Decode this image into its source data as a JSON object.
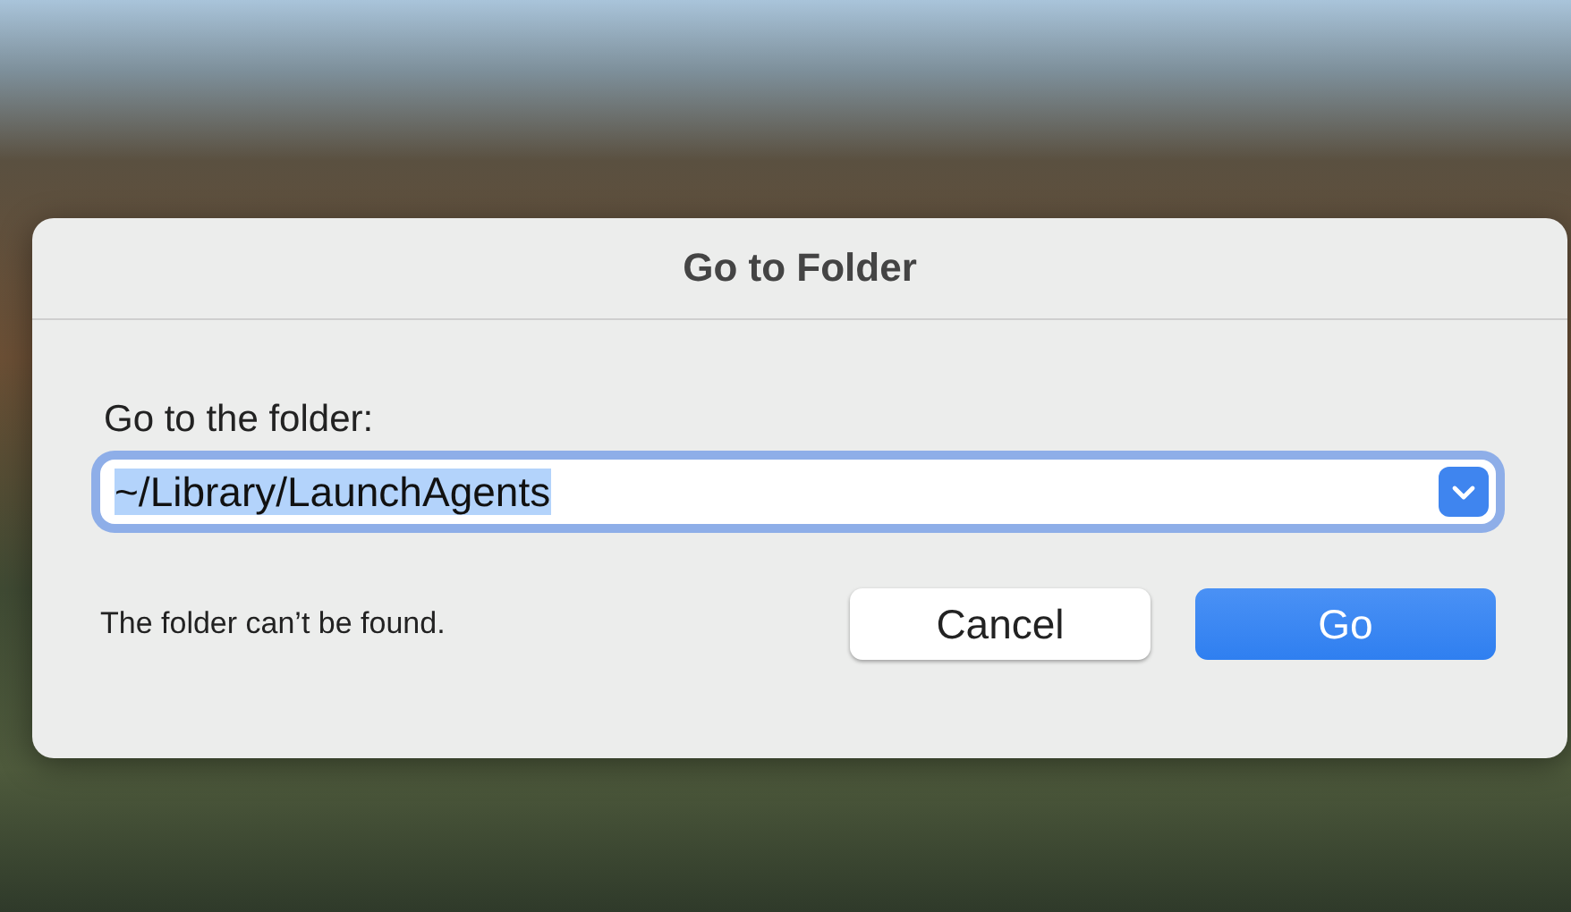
{
  "dialog": {
    "title": "Go to Folder",
    "label": "Go to the folder:",
    "field": {
      "value": "~/Library/LaunchAgents",
      "text_selected": true,
      "focused": true
    },
    "message": "The folder can’t be found.",
    "buttons": [
      {
        "label": "Cancel",
        "default": false
      },
      {
        "label": "Go",
        "default": true
      }
    ]
  }
}
